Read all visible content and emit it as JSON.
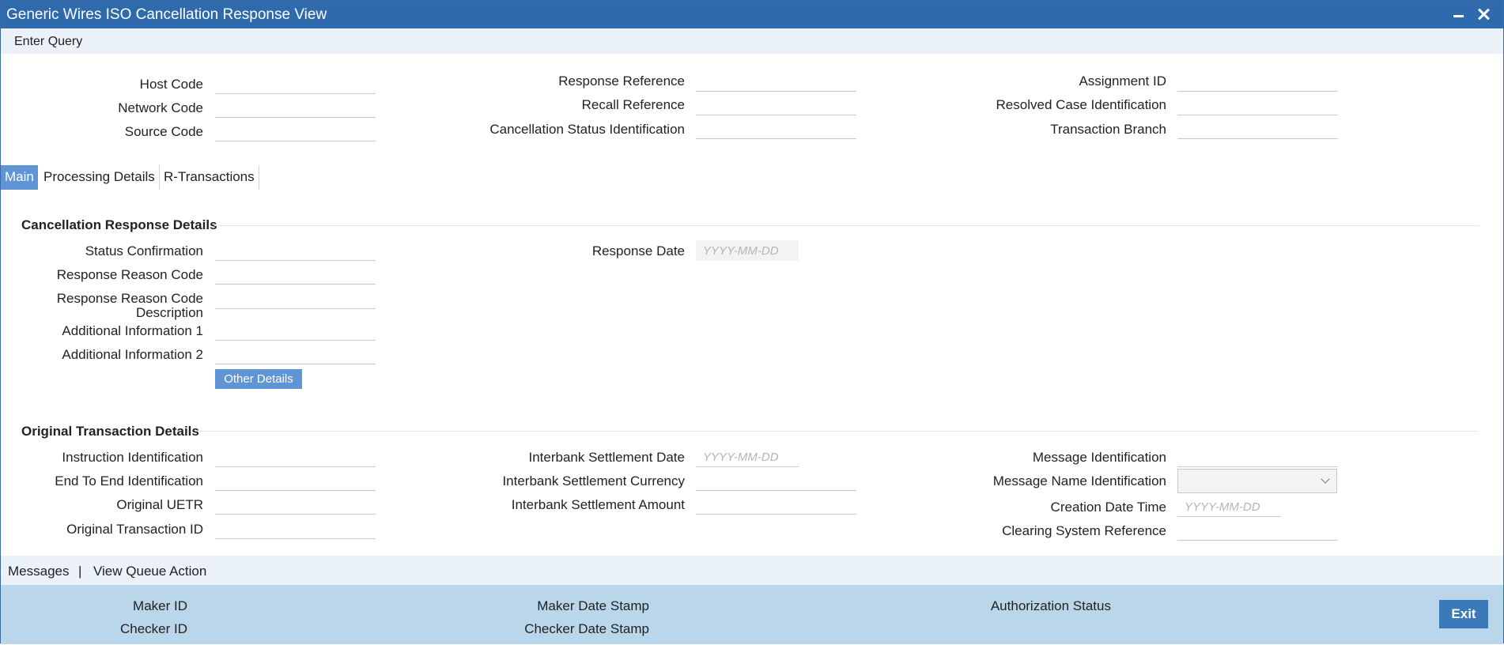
{
  "window": {
    "title": "Generic Wires ISO Cancellation Response View"
  },
  "toolbar": {
    "enter_query": "Enter Query"
  },
  "header": {
    "host_code": "Host Code",
    "network_code": "Network Code",
    "source_code": "Source Code",
    "response_reference": "Response Reference",
    "recall_reference": "Recall Reference",
    "cancellation_status_identification": "Cancellation Status Identification",
    "assignment_id": "Assignment ID",
    "resolved_case_identification": "Resolved Case Identification",
    "transaction_branch": "Transaction Branch"
  },
  "tabs": [
    {
      "label": "Main",
      "active": true
    },
    {
      "label": "Processing Details",
      "active": false
    },
    {
      "label": "R-Transactions",
      "active": false
    }
  ],
  "cancellation_response": {
    "title": "Cancellation Response Details",
    "status_confirmation": "Status Confirmation",
    "response_reason_code": "Response Reason Code",
    "response_reason_code_description_1": "Response Reason Code",
    "response_reason_code_description_2": "Description",
    "additional_information_1": "Additional Information 1",
    "additional_information_2": "Additional Information 2",
    "other_details_button": "Other Details",
    "response_date": "Response Date",
    "date_placeholder": "YYYY-MM-DD"
  },
  "original_transaction": {
    "title": "Original Transaction Details",
    "instruction_identification": "Instruction Identification",
    "end_to_end_identification": "End To End Identification",
    "original_uetr": "Original UETR",
    "original_transaction_id": "Original Transaction ID",
    "interbank_settlement_date": "Interbank Settlement Date",
    "interbank_settlement_currency": "Interbank Settlement Currency",
    "interbank_settlement_amount": "Interbank Settlement Amount",
    "message_identification": "Message Identification",
    "message_name_identification": "Message Name Identification",
    "creation_date_time": "Creation Date Time",
    "clearing_system_reference": "Clearing System Reference",
    "date_placeholder": "YYYY-MM-DD"
  },
  "messages_bar": {
    "messages": "Messages",
    "separator": "|",
    "view_queue_action": "View Queue Action"
  },
  "footer": {
    "maker_id": "Maker ID",
    "checker_id": "Checker ID",
    "maker_date_stamp": "Maker Date Stamp",
    "checker_date_stamp": "Checker Date Stamp",
    "authorization_status": "Authorization Status",
    "exit": "Exit"
  },
  "colors": {
    "title_bar": "#2f6aad",
    "accent": "#5f95d4",
    "footer": "#bad6ea",
    "toolbar": "#eaf1f8"
  }
}
